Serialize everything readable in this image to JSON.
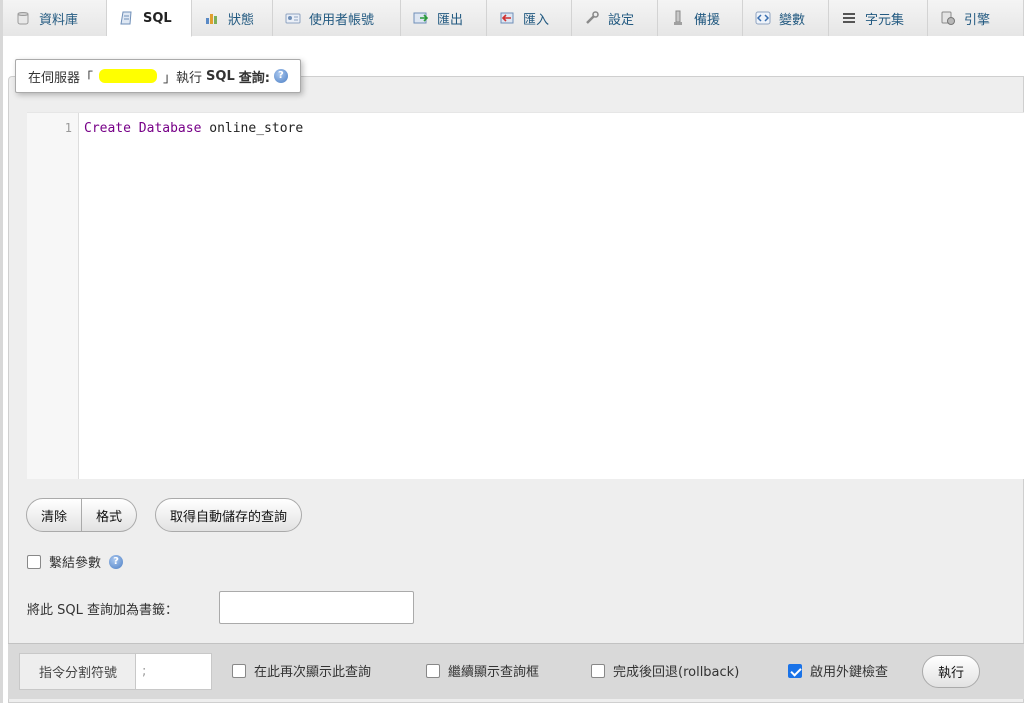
{
  "tabs": [
    {
      "label": "資料庫",
      "icon": "database-icon",
      "active": false
    },
    {
      "label": "SQL",
      "icon": "sql-icon",
      "active": true
    },
    {
      "label": "狀態",
      "icon": "status-chart-icon",
      "active": false
    },
    {
      "label": "使用者帳號",
      "icon": "user-accounts-icon",
      "active": false
    },
    {
      "label": "匯出",
      "icon": "export-icon",
      "active": false
    },
    {
      "label": "匯入",
      "icon": "import-icon",
      "active": false
    },
    {
      "label": "設定",
      "icon": "wrench-icon",
      "active": false
    },
    {
      "label": "備援",
      "icon": "replication-icon",
      "active": false
    },
    {
      "label": "變數",
      "icon": "variables-icon",
      "active": false
    },
    {
      "label": "字元集",
      "icon": "charset-icon",
      "active": false
    },
    {
      "label": "引擎",
      "icon": "engines-icon",
      "active": false
    }
  ],
  "legend": {
    "prefix": "在伺服器「",
    "suffix": "」執行",
    "sql": "SQL",
    "query": "查詢:"
  },
  "editor": {
    "line_number": "1",
    "kw1": "Create",
    "kw2": "Database",
    "ident": "online_store"
  },
  "buttons": {
    "clear": "清除",
    "format": "格式",
    "autosave": "取得自動儲存的查詢"
  },
  "bind_params": {
    "label": "繫結參數",
    "checked": false
  },
  "bookmark": {
    "label": "將此 SQL 查詢加為書籤：",
    "value": ""
  },
  "bottom": {
    "delimiter_label": "指令分割符號",
    "delimiter_value": ";",
    "show_query_again": {
      "label": "在此再次顯示此查詢",
      "checked": false
    },
    "retain_box": {
      "label": "繼續顯示查詢框",
      "checked": false
    },
    "rollback": {
      "label": "完成後回退(rollback)",
      "checked": false
    },
    "foreign_key": {
      "label": "啟用外鍵檢查",
      "checked": true
    },
    "go": "執行"
  }
}
